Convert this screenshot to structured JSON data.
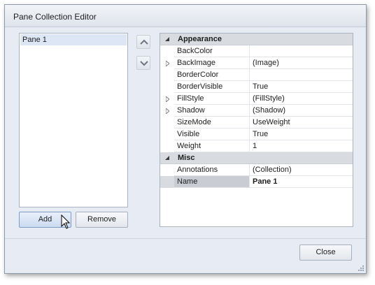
{
  "window": {
    "title": "Pane Collection Editor"
  },
  "list": {
    "items": [
      {
        "label": "Pane 1",
        "selected": true
      }
    ]
  },
  "icons": {
    "up": "chevron-up-icon",
    "down": "chevron-down-icon",
    "collapse": "collapse-triangle-icon",
    "expand": "expand-triangle-icon",
    "cursor": "mouse-pointer-icon",
    "grip": "resize-grip-icon"
  },
  "propgrid": {
    "categories": [
      {
        "label": "Appearance",
        "rows": [
          {
            "name": "BackColor",
            "value": ""
          },
          {
            "name": "BackImage",
            "value": "(Image)",
            "expandable": true
          },
          {
            "name": "BorderColor",
            "value": ""
          },
          {
            "name": "BorderVisible",
            "value": "True"
          },
          {
            "name": "FillStyle",
            "value": "(FillStyle)",
            "expandable": true
          },
          {
            "name": "Shadow",
            "value": "(Shadow)",
            "expandable": true
          },
          {
            "name": "SizeMode",
            "value": "UseWeight"
          },
          {
            "name": "Visible",
            "value": "True"
          },
          {
            "name": "Weight",
            "value": "1"
          }
        ]
      },
      {
        "label": "Misc",
        "rows": [
          {
            "name": "Annotations",
            "value": "(Collection)"
          },
          {
            "name": "Name",
            "value": "Pane 1",
            "selected": true
          }
        ]
      }
    ]
  },
  "buttons": {
    "add": "Add",
    "remove": "Remove",
    "close": "Close"
  },
  "colors": {
    "window_bg": "#e7ecf4",
    "selection": "#dce6f5",
    "category_bg": "#d8dbe0"
  }
}
